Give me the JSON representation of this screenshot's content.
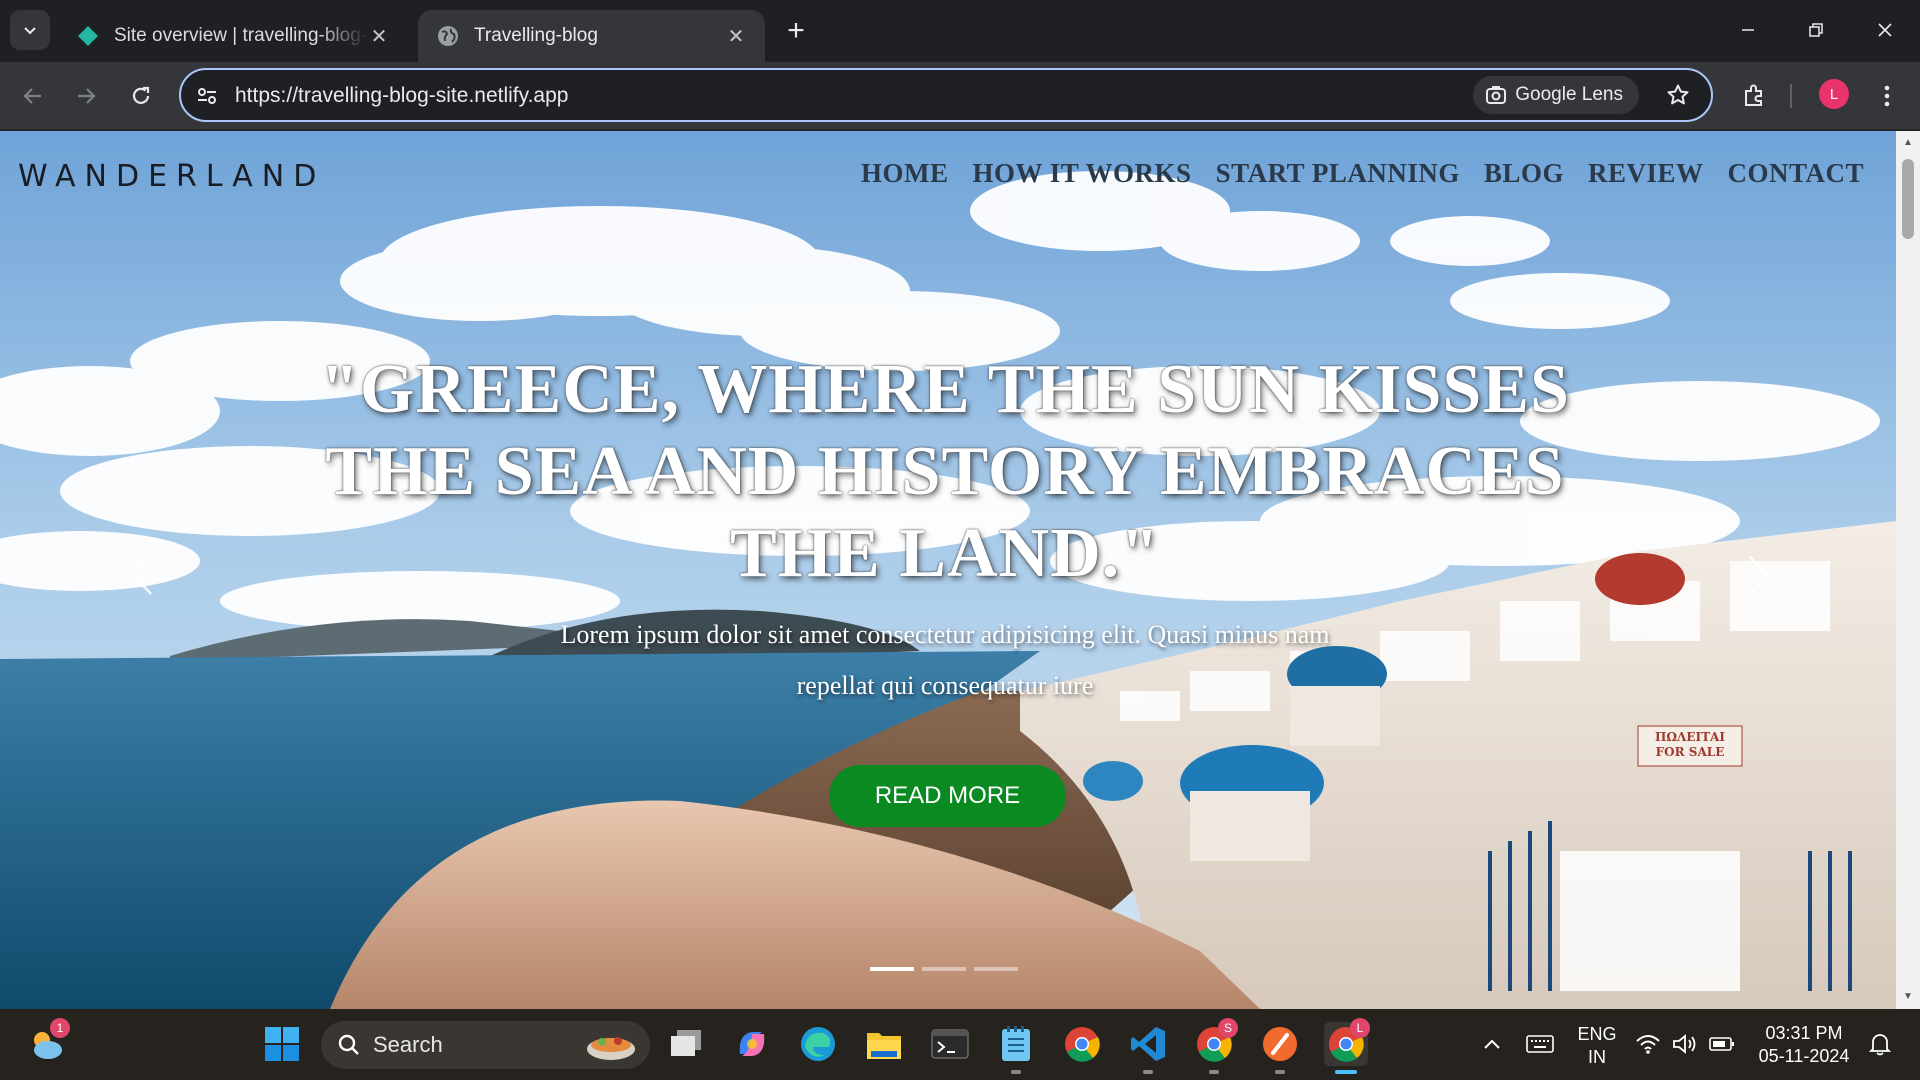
{
  "browser": {
    "tabs": [
      {
        "title": "Site overview | travelling-blog-site",
        "close": "✕"
      },
      {
        "title": "Travelling-blog",
        "close": "✕"
      }
    ],
    "new_tab": "+",
    "url": "https://travelling-blog-site.netlify.app",
    "lens_label": "Google Lens",
    "profile_initial": "L"
  },
  "site": {
    "logo": "WANDERLAND",
    "nav": [
      "HOME",
      "HOW IT WORKS",
      "START PLANNING",
      "BLOG",
      "REVIEW",
      "CONTACT"
    ],
    "headline": "\"GREECE, WHERE THE SUN KISSES THE SEA AND HISTORY EMBRACES THE LAND.\"",
    "subtext": "Lorem ipsum dolor sit amet consectetur adipisicing elit. Quasi minus nam repellat qui consequatur iure",
    "button": "READ MORE",
    "carousel_slides": 3,
    "carousel_active": 1
  },
  "taskbar": {
    "search_placeholder": "Search",
    "widget_badge": "1",
    "lang_top": "ENG",
    "lang_bottom": "IN",
    "time": "03:31 PM",
    "date": "05-11-2024",
    "chrome1_badge": "S",
    "chrome2_badge": "L"
  },
  "colors": {
    "accent_button": "#0b8a22",
    "omnibox_border": "#a8c7fa",
    "profile": "#e8336d"
  }
}
